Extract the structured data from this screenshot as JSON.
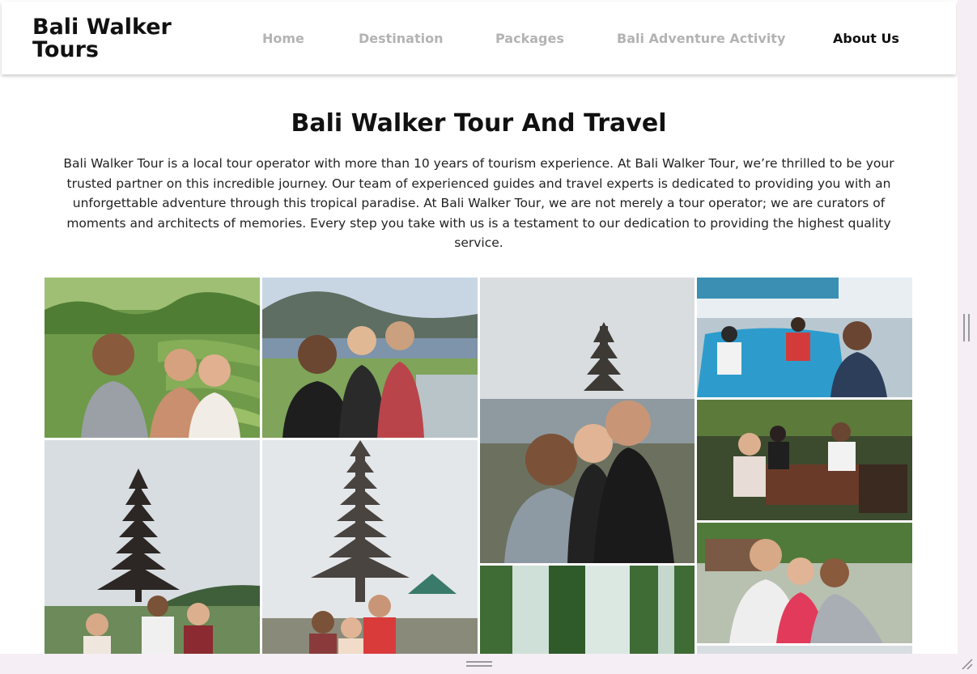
{
  "brand": {
    "line1": "Bali Walker",
    "line2": "Tours"
  },
  "nav": {
    "items": [
      {
        "label": "Home",
        "active": false
      },
      {
        "label": "Destination",
        "active": false
      },
      {
        "label": "Packages",
        "active": false
      },
      {
        "label": "Bali Adventure Activity",
        "active": false
      },
      {
        "label": "About Us",
        "active": true
      }
    ]
  },
  "about": {
    "title": "Bali Walker Tour And Travel",
    "description": "Bali Walker Tour is a local tour operator with more than 10 years of tourism experience.  At Bali Walker Tour, we’re thrilled to be your trusted partner on this incredible journey. Our team of experienced guides and  travel experts is dedicated to providing you with an unforgettable adventure through this tropical paradise. At Bali Walker Tour, we are not merely a tour operator; we are curators of moments and architects of memories. Every step you take with us is a testament to our dedication to providing the highest quality service."
  },
  "gallery": {
    "photos": [
      {
        "name": "rice-terrace-selfie-photo"
      },
      {
        "name": "mountain-lake-viewpoint-photo"
      },
      {
        "name": "lake-temple-group-selfie-photo"
      },
      {
        "name": "boat-trip-photo"
      },
      {
        "name": "restaurant-lunch-photo"
      },
      {
        "name": "temple-pagoda-group-photo"
      },
      {
        "name": "ulun-danu-temple-photo"
      },
      {
        "name": "waterfall-photo"
      },
      {
        "name": "street-selfie-photo"
      }
    ]
  },
  "colors": {
    "nav_inactive": "#b3b3b3",
    "nav_active": "#111111",
    "chrome_background": "#f5eef5"
  }
}
